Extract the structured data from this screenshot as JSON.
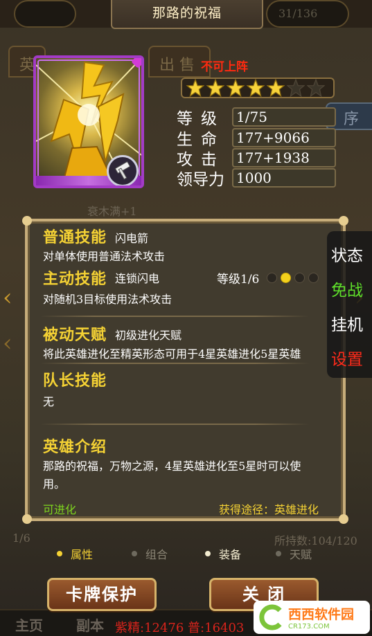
{
  "title": "那路的祝福",
  "hud": {
    "left_value": "",
    "right_value": "31/136"
  },
  "bg_tabs": {
    "hero_tab": "英",
    "sell_tab": "出 售",
    "sort_tab": "序"
  },
  "bg_list": {
    "row1": "衰木满+1",
    "row2": "1/6",
    "row3": "所持数:104/120"
  },
  "bg_bottom": {
    "home": "主页",
    "dungeon": "副本"
  },
  "card": {
    "status": "不可上阵",
    "star_count": 5,
    "max_stars": 7
  },
  "stats": [
    {
      "label": "等级",
      "value": "1/75"
    },
    {
      "label": "生命",
      "value": "177+9066"
    },
    {
      "label": "攻击",
      "value": "177+1938"
    },
    {
      "label": "领导力",
      "value": "1000"
    }
  ],
  "skills": {
    "normal": {
      "title": "普通技能",
      "name": "闪电箭",
      "desc": "对单体使用普通法术攻击"
    },
    "active": {
      "title": "主动技能",
      "name": "连锁闪电",
      "level": "等级1/6",
      "level_current": 2,
      "level_total": 4,
      "desc": "对随机3目标使用法术攻击"
    },
    "passive": {
      "title": "被动天赋",
      "name": "初级进化天赋",
      "desc": "将此英雄进化至精英形态可用于4星英雄进化5星英雄"
    },
    "leader": {
      "title": "队长技能",
      "desc": "无"
    },
    "intro": {
      "title": "英雄介绍",
      "desc_line1": "那路的祝福，万物之源，4星英雄进化至5星时可以使",
      "desc_line2": "用。"
    }
  },
  "footer": {
    "evolve": "可进化",
    "source": "获得途径：英雄进化"
  },
  "side_menu": [
    {
      "label": "状态",
      "color": "#ffffff"
    },
    {
      "label": "免战",
      "color": "#5ee02a"
    },
    {
      "label": "挂机",
      "color": "#ffffff"
    },
    {
      "label": "设置",
      "color": "#ff2a1a"
    }
  ],
  "tabs": [
    {
      "label": "属性",
      "active": true
    },
    {
      "label": "组合",
      "active": false
    },
    {
      "label": "装备",
      "active": false
    },
    {
      "label": "天赋",
      "active": false
    }
  ],
  "buttons": {
    "protect": "卡牌保护",
    "close": "关  闭"
  },
  "resources": "紫精:12476 普:16403",
  "watermark": {
    "brand": "西西软件园",
    "url": "CR173.COM"
  },
  "colors": {
    "accent_gold": "#f5d234",
    "warning_red": "#ff2a10",
    "evolve_green": "#7ed51e",
    "card_border": "#a33bc6"
  },
  "icons": {
    "weapon": "hammer-icon",
    "star": "star-icon"
  }
}
